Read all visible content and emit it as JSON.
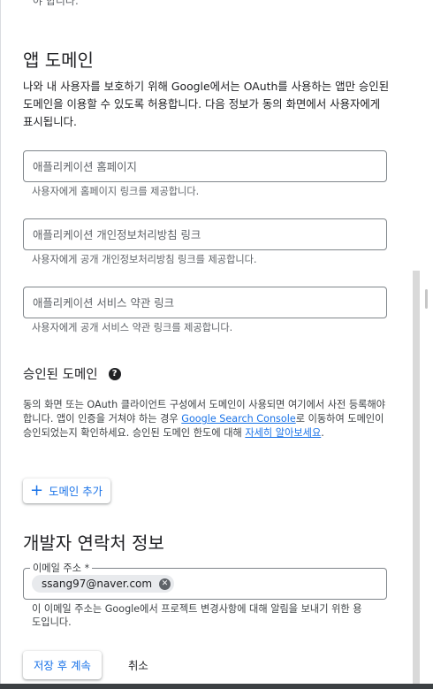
{
  "top_cut_text": "야 합니다.",
  "app_domain": {
    "heading": "앱 도메인",
    "intro": "나와 내 사용자를 보호하기 위해 Google에서는 OAuth를 사용하는 앱만 승인된 도메인을 이용할 수 있도록 허용합니다. 다음 정보가 동의 화면에서 사용자에게 표시됩니다."
  },
  "fields": [
    {
      "placeholder": "애플리케이션 홈페이지",
      "value": "",
      "helper": "사용자에게 홈페이지 링크를 제공합니다."
    },
    {
      "placeholder": "애플리케이션 개인정보처리방침 링크",
      "value": "",
      "helper": "사용자에게 공개 개인정보처리방침 링크를 제공합니다."
    },
    {
      "placeholder": "애플리케이션 서비스 약관 링크",
      "value": "",
      "helper": "사용자에게 공개 서비스 약관 링크를 제공합니다."
    }
  ],
  "authorized_domains": {
    "title": "승인된 도메인",
    "help_icon": "help-circle-icon",
    "desc_part1": "동의 화면 또는 OAuth 클라이언트 구성에서 도메인이 사용되면 여기에서 사전 등록해야 합니다. 앱이 인증을 거쳐야 하는 경우 ",
    "link_search_console": "Google Search Console",
    "desc_part2": "로 이동하여 도메인이 승인되었는지 확인하세요. 승인된 도메인 한도에 대해 ",
    "link_learn_more": "자세히 알아보세요",
    "desc_part3": ".",
    "add_button": "도메인 추가",
    "add_icon": "plus-icon"
  },
  "developer_contact": {
    "heading": "개발자 연락처 정보",
    "email_label": "이메일 주소 *",
    "email_chip": "ssang97@naver.com",
    "remove_icon": "cancel-circle-icon",
    "hint": "이 이메일 주소는 Google에서 프로젝트 변경사항에 대해 알림을 보내기 위한 용도입니다."
  },
  "actions": {
    "save": "저장 후 계속",
    "cancel": "취소"
  },
  "colors": {
    "accent": "#1a73e8",
    "text": "#202124",
    "secondary_text": "#5f6368"
  }
}
